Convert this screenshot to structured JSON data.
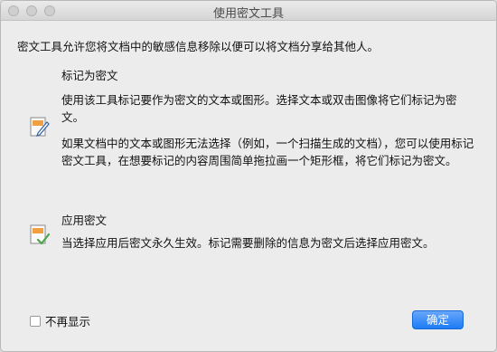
{
  "window": {
    "title": "使用密文工具"
  },
  "intro": "密文工具允许您将文档中的敏感信息移除以便可以将文档分享给其他人。",
  "mark_section": {
    "title": "标记为密文",
    "icon": "mark-redaction-icon",
    "para1": "使用该工具标记要作为密文的文本或图形。选择文本或双击图像将它们标记为密文。",
    "para2": "如果文档中的文本或图形无法选择（例如，一个扫描生成的文档），您可以使用标记密文工具，在想要标记的内容周围简单拖拉画一个矩形框，将它们标记为密文。"
  },
  "apply_section": {
    "title": "应用密文",
    "icon": "apply-redaction-icon",
    "para": "当选择应用后密文永久生效。标记需要删除的信息为密文后选择应用密文。"
  },
  "footer": {
    "dont_show_label": "不再显示",
    "dont_show_checked": false,
    "ok_label": "确定"
  },
  "colors": {
    "accent": "#1c7cf5",
    "icon_orange": "#f0a040"
  }
}
